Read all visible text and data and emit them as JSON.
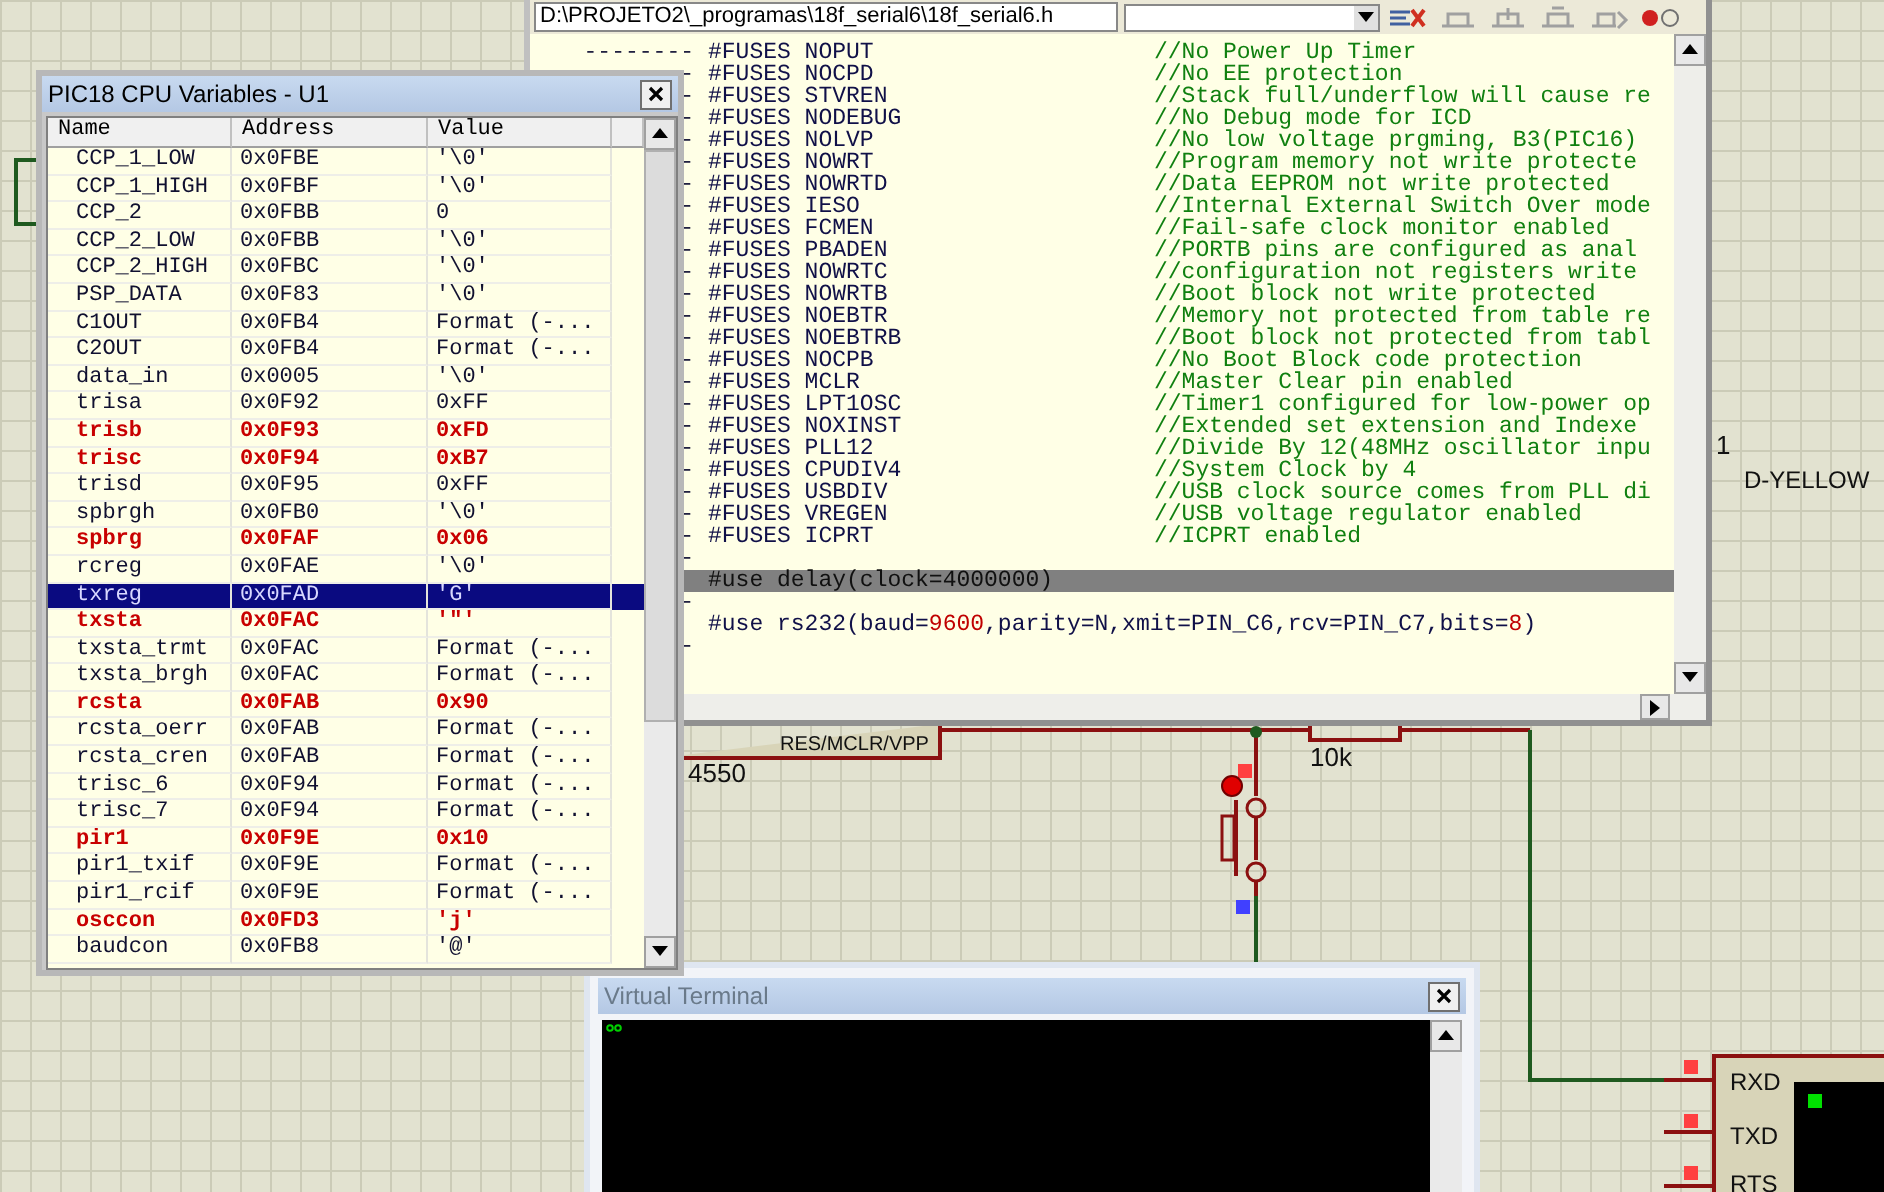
{
  "schematic": {
    "labels": [
      {
        "text": "RES/MCLR/VPP"
      },
      {
        "text": "4550"
      },
      {
        "text": "10k"
      },
      {
        "text": "1"
      },
      {
        "text": "D-YELLOW"
      },
      {
        "text": "RXD"
      },
      {
        "text": "TXD"
      },
      {
        "text": "RTS"
      }
    ]
  },
  "source_window": {
    "path": "D:\\PROJETO2\\_programas\\18f_serial6\\18f_serial6.h",
    "code_lines": [
      {
        "marker": "--------",
        "code": "#FUSES NOPUT",
        "comment": "//No Power Up Timer",
        "current": false
      },
      {
        "marker": "-",
        "code": "#FUSES NOCPD",
        "comment": "//No EE protection",
        "current": false
      },
      {
        "marker": "-",
        "code": "#FUSES STVREN",
        "comment": "//Stack full/underflow will cause re",
        "current": false
      },
      {
        "marker": "-",
        "code": "#FUSES NODEBUG",
        "comment": "//No Debug mode for ICD",
        "current": false
      },
      {
        "marker": "-",
        "code": "#FUSES NOLVP",
        "comment": "//No low voltage prgming, B3(PIC16)",
        "current": false
      },
      {
        "marker": "-",
        "code": "#FUSES NOWRT",
        "comment": "//Program memory not write protecte",
        "current": false
      },
      {
        "marker": "-",
        "code": "#FUSES NOWRTD",
        "comment": "//Data EEPROM not write protected",
        "current": false
      },
      {
        "marker": "-",
        "code": "#FUSES IESO",
        "comment": "//Internal External Switch Over mode",
        "current": false
      },
      {
        "marker": "-",
        "code": "#FUSES FCMEN",
        "comment": "//Fail-safe clock monitor enabled",
        "current": false
      },
      {
        "marker": "-",
        "code": "#FUSES PBADEN",
        "comment": "//PORTB pins are configured as anal",
        "current": false
      },
      {
        "marker": "-",
        "code": "#FUSES NOWRTC",
        "comment": "//configuration not registers write",
        "current": false
      },
      {
        "marker": "-",
        "code": "#FUSES NOWRTB",
        "comment": "//Boot block not write protected",
        "current": false
      },
      {
        "marker": "-",
        "code": "#FUSES NOEBTR",
        "comment": "//Memory not protected from table re",
        "current": false
      },
      {
        "marker": "-",
        "code": "#FUSES NOEBTRB",
        "comment": "//Boot block not protected from tabl",
        "current": false
      },
      {
        "marker": "-",
        "code": "#FUSES NOCPB",
        "comment": "//No Boot Block code protection",
        "current": false
      },
      {
        "marker": "-",
        "code": "#FUSES MCLR",
        "comment": "//Master Clear pin enabled",
        "current": false
      },
      {
        "marker": "-",
        "code": "#FUSES LPT1OSC",
        "comment": "//Timer1 configured for low-power op",
        "current": false
      },
      {
        "marker": "-",
        "code": "#FUSES NOXINST",
        "comment": "//Extended set extension and Indexe",
        "current": false
      },
      {
        "marker": "-",
        "code": "#FUSES PLL12",
        "comment": "//Divide By 12(48MHz oscillator inpu",
        "current": false
      },
      {
        "marker": "-",
        "code": "#FUSES CPUDIV4",
        "comment": "//System Clock by 4",
        "current": false
      },
      {
        "marker": "-",
        "code": "#FUSES USBDIV",
        "comment": "//USB clock source comes from PLL di",
        "current": false
      },
      {
        "marker": "-",
        "code": "#FUSES VREGEN",
        "comment": "//USB voltage regulator enabled",
        "current": false
      },
      {
        "marker": "-",
        "code": "#FUSES ICPRT",
        "comment": "//ICPRT enabled",
        "current": false
      },
      {
        "marker": "-",
        "current": false
      },
      {
        "code": "#use delay(clock=4000000)",
        "current": true
      },
      {
        "marker": "-",
        "current": false
      },
      {
        "segments": [
          {
            "text": "#use rs232(baud=",
            "kind": "plain"
          },
          {
            "text": "9600",
            "kind": "number"
          },
          {
            "text": ",parity=N,xmit=PIN_C6,rcv=PIN_C7,bits=",
            "kind": "plain"
          },
          {
            "text": "8",
            "kind": "number"
          },
          {
            "text": ")",
            "kind": "plain"
          }
        ],
        "current": false
      },
      {
        "marker": "-",
        "current": false
      }
    ]
  },
  "cpu_variables": {
    "title": "PIC18 CPU Variables - U1",
    "columns": [
      "Name",
      "Address",
      "Value"
    ],
    "rows": [
      {
        "name": "CCP_1_LOW",
        "address": "0x0FBE",
        "value": "'\\0'",
        "changed": false,
        "selected": false
      },
      {
        "name": "CCP_1_HIGH",
        "address": "0x0FBF",
        "value": "'\\0'",
        "changed": false,
        "selected": false
      },
      {
        "name": "CCP_2",
        "address": "0x0FBB",
        "value": "0",
        "changed": false,
        "selected": false
      },
      {
        "name": "CCP_2_LOW",
        "address": "0x0FBB",
        "value": "'\\0'",
        "changed": false,
        "selected": false
      },
      {
        "name": "CCP_2_HIGH",
        "address": "0x0FBC",
        "value": "'\\0'",
        "changed": false,
        "selected": false
      },
      {
        "name": "PSP_DATA",
        "address": "0x0F83",
        "value": "'\\0'",
        "changed": false,
        "selected": false
      },
      {
        "name": "C1OUT",
        "address": "0x0FB4",
        "value": "Format (-...",
        "changed": false,
        "selected": false
      },
      {
        "name": "C2OUT",
        "address": "0x0FB4",
        "value": "Format (-...",
        "changed": false,
        "selected": false
      },
      {
        "name": "data_in",
        "address": "0x0005",
        "value": "'\\0'",
        "changed": false,
        "selected": false
      },
      {
        "name": "trisa",
        "address": "0x0F92",
        "value": "0xFF",
        "changed": false,
        "selected": false
      },
      {
        "name": "trisb",
        "address": "0x0F93",
        "value": "0xFD",
        "changed": true,
        "selected": false
      },
      {
        "name": "trisc",
        "address": "0x0F94",
        "value": "0xB7",
        "changed": true,
        "selected": false
      },
      {
        "name": "trisd",
        "address": "0x0F95",
        "value": "0xFF",
        "changed": false,
        "selected": false
      },
      {
        "name": "spbrgh",
        "address": "0x0FB0",
        "value": "'\\0'",
        "changed": false,
        "selected": false
      },
      {
        "name": "spbrg",
        "address": "0x0FAF",
        "value": "0x06",
        "changed": true,
        "selected": false
      },
      {
        "name": "rcreg",
        "address": "0x0FAE",
        "value": "'\\0'",
        "changed": false,
        "selected": false
      },
      {
        "name": "txreg",
        "address": "0x0FAD",
        "value": "'G'",
        "changed": false,
        "selected": true
      },
      {
        "name": "txsta",
        "address": "0x0FAC",
        "value": "'\"'",
        "changed": true,
        "selected": false
      },
      {
        "name": "txsta_trmt",
        "address": "0x0FAC",
        "value": "Format (-...",
        "changed": false,
        "selected": false
      },
      {
        "name": "txsta_brgh",
        "address": "0x0FAC",
        "value": "Format (-...",
        "changed": false,
        "selected": false
      },
      {
        "name": "rcsta",
        "address": "0x0FAB",
        "value": "0x90",
        "changed": true,
        "selected": false
      },
      {
        "name": "rcsta_oerr",
        "address": "0x0FAB",
        "value": "Format (-...",
        "changed": false,
        "selected": false
      },
      {
        "name": "rcsta_cren",
        "address": "0x0FAB",
        "value": "Format (-...",
        "changed": false,
        "selected": false
      },
      {
        "name": "trisc_6",
        "address": "0x0F94",
        "value": "Format (-...",
        "changed": false,
        "selected": false
      },
      {
        "name": "trisc_7",
        "address": "0x0F94",
        "value": "Format (-...",
        "changed": false,
        "selected": false
      },
      {
        "name": "pir1",
        "address": "0x0F9E",
        "value": "0x10",
        "changed": true,
        "selected": false
      },
      {
        "name": "pir1_txif",
        "address": "0x0F9E",
        "value": "Format (-...",
        "changed": false,
        "selected": false
      },
      {
        "name": "pir1_rcif",
        "address": "0x0F9E",
        "value": "Format (-...",
        "changed": false,
        "selected": false
      },
      {
        "name": "osccon",
        "address": "0x0FD3",
        "value": "'j'",
        "changed": true,
        "selected": false
      },
      {
        "name": "baudcon",
        "address": "0x0FB8",
        "value": "'@'",
        "changed": false,
        "selected": false
      }
    ]
  },
  "virtual_terminal": {
    "title": "Virtual Terminal"
  }
}
